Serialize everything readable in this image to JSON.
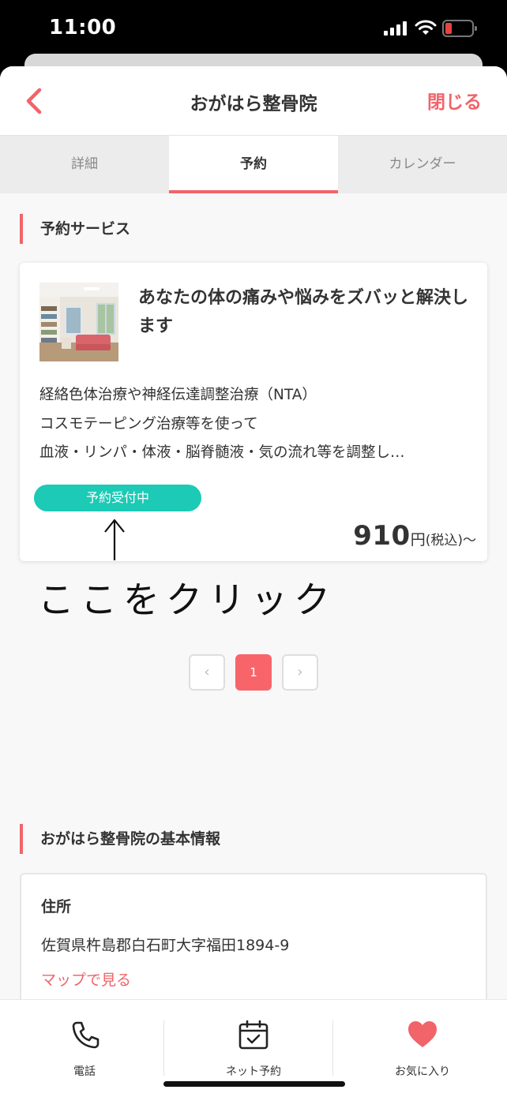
{
  "status_bar": {
    "time": "11:00",
    "icons": [
      "cellular-signal-icon",
      "wifi-icon",
      "battery-low-icon"
    ],
    "battery_color": "#e8433f"
  },
  "header": {
    "back_icon": "chevron-left-icon",
    "title": "おがはら整骨院",
    "close_label": "閉じる"
  },
  "tabs": [
    {
      "label": "詳細",
      "active": false
    },
    {
      "label": "予約",
      "active": true
    },
    {
      "label": "カレンダー",
      "active": false
    }
  ],
  "reservation_section": {
    "heading": "予約サービス",
    "service": {
      "image": "clinic-interior-photo",
      "title": "あなたの体の痛みや悩みをズバッと解決します",
      "description_lines": [
        "経絡色体治療や神経伝達調整治療（NTA）",
        "コスモテーピング治療等を使って",
        "血液・リンパ・体液・脳脊髄液・気の流れ等を調整し…"
      ],
      "status": "予約受付中",
      "price_number": "910",
      "price_unit": "円",
      "price_suffix": "(税込)〜"
    },
    "annotation": {
      "arrow": "↑",
      "text": "ここをクリック"
    }
  },
  "pagination": {
    "prev": "‹",
    "current": "1",
    "next": "›"
  },
  "info_section": {
    "heading": "おがはら整骨院の基本情報",
    "address_label": "住所",
    "address": "佐賀県杵島郡白石町大字福田1894-9",
    "map_link": "マップで見る"
  },
  "bottom_nav": [
    {
      "label": "電話",
      "icon": "phone-icon"
    },
    {
      "label": "ネット予約",
      "icon": "calendar-check-icon"
    },
    {
      "label": "お気に入り",
      "icon": "heart-icon"
    }
  ],
  "colors": {
    "accent": "#f0646a",
    "status_pill": "#1ccab5",
    "favorite": "#f0646a"
  }
}
